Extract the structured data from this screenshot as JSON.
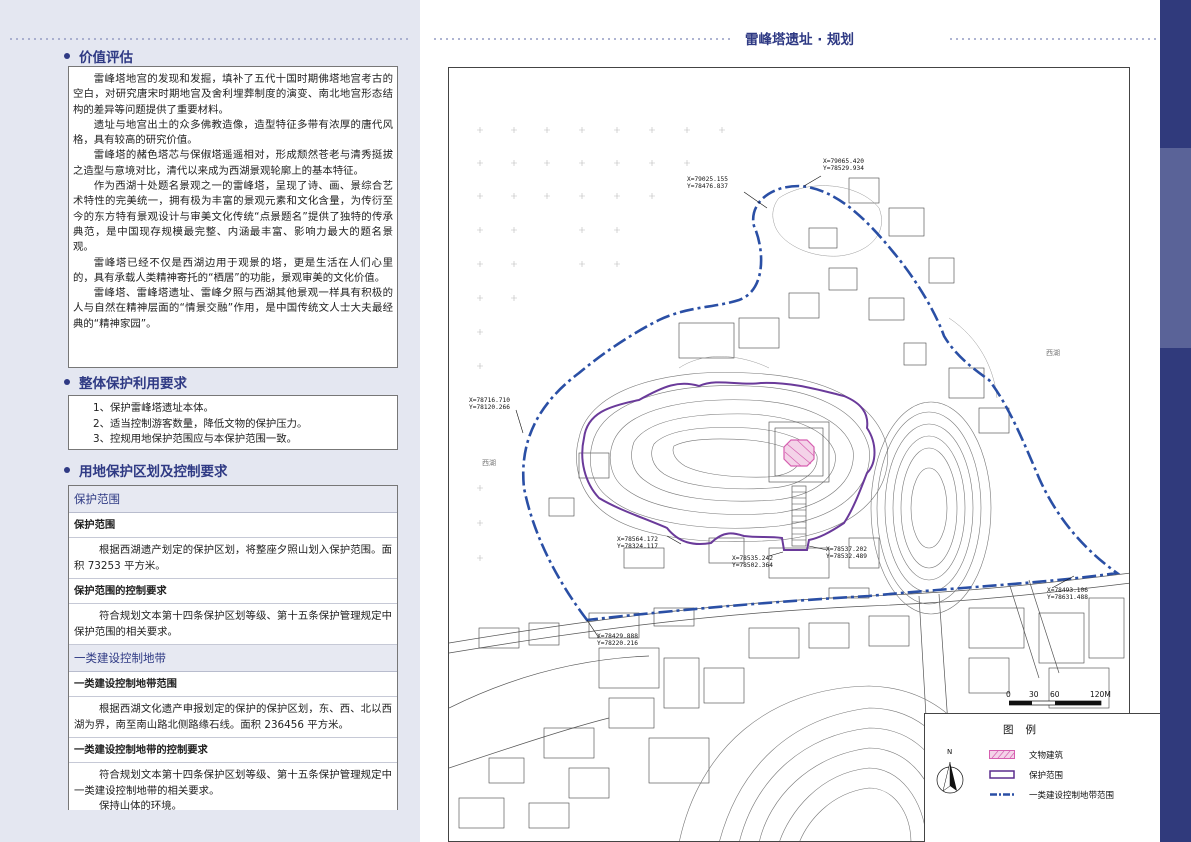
{
  "header": {
    "map_title": "雷峰塔遗址 · 规划"
  },
  "value_section": {
    "heading": "价值评估",
    "paragraphs": [
      "雷峰塔地宫的发现和发掘，填补了五代十国时期佛塔地宫考古的空白，对研究唐宋时期地宫及舍利埋葬制度的演变、南北地宫形态结构的差异等问题提供了重要材料。",
      "遗址与地宫出土的众多佛教造像，造型特征多带有浓厚的唐代风格，具有较高的研究价值。",
      "雷峰塔的赭色塔芯与保俶塔遥遥相对，形成颓然苍老与清秀挺拔之造型与意境对比，清代以来成为西湖景观轮廓上的基本特征。",
      "作为西湖十处题名景观之一的雷峰塔，呈现了诗、画、景综合艺术特性的完美统一，拥有极为丰富的景观元素和文化含量，为传衍至今的东方特有景观设计与审美文化传统“点景题名”提供了独特的传承典范，是中国现存规模最完整、内涵最丰富、影响力最大的题名景观。",
      "雷峰塔已经不仅是西湖边用于观景的塔，更是生活在人们心里的，具有承载人类精神寄托的“栖居”的功能，景观审美的文化价值。",
      "雷峰塔、雷峰塔遗址、雷峰夕照与西湖其他景观一样具有积极的人与自然在精神层面的“情景交融”作用，是中国传统文人士大夫最经典的“精神家园”。"
    ]
  },
  "requirements_section": {
    "heading": "整体保护利用要求",
    "items": [
      "1、保护雷峰塔遗址本体。",
      "2、适当控制游客数量，降低文物的保护压力。",
      "3、控规用地保护范围应与本保护范围一致。"
    ]
  },
  "zoning_section": {
    "heading": "用地保护区划及控制要求",
    "protect_title": "保护范围",
    "protect_sub1": "保护范围",
    "protect_text1": "根据西湖遗产划定的保护区划，将整座夕照山划入保护范围。面积 73253 平方米。",
    "protect_sub2": "保护范围的控制要求",
    "protect_text2": "符合规划文本第十四条保护区划等级、第十五条保护管理规定中保护范围的相关要求。",
    "zone1_title": "一类建设控制地带",
    "zone1_sub1": "一类建设控制地带范围",
    "zone1_text1": "根据西湖文化遗产申报划定的保护的保护区划，东、西、北以西湖为界，南至南山路北侧路缘石线。面积 236456 平方米。",
    "zone1_sub2": "一类建设控制地带的控制要求",
    "zone1_text2": "符合规划文本第十四条保护区划等级、第十五条保护管理规定中一类建设控制地带的相关要求。",
    "zone1_text3": "保持山体的环境。"
  },
  "map": {
    "coordinates": [
      {
        "x": "X=79065.420",
        "y": "Y=78529.934"
      },
      {
        "x": "X=79025.155",
        "y": "Y=78476.837"
      },
      {
        "x": "X=78716.710",
        "y": "Y=78120.266"
      },
      {
        "x": "X=78564.172",
        "y": "Y=78324.117"
      },
      {
        "x": "X=78535.242",
        "y": "Y=78502.364"
      },
      {
        "x": "X=78537.202",
        "y": "Y=78532.489"
      },
      {
        "x": "X=78493.106",
        "y": "Y=78631.488"
      },
      {
        "x": "X=78429.888",
        "y": "Y=78220.216"
      }
    ],
    "places": {
      "west": "西湖",
      "east": "西湖"
    },
    "scale_labels": [
      "0",
      "30",
      "60",
      "120M"
    ],
    "north_label": "N"
  },
  "legend": {
    "title": "图例",
    "items": [
      {
        "label": "文物建筑",
        "color": "#d65fb0"
      },
      {
        "label": "保护范围",
        "color": "#5b2d8e"
      },
      {
        "label": "一类建设控制地带范围",
        "color": "#2a4fa5"
      }
    ]
  },
  "colors": {
    "accent": "#2f3a84",
    "protect_line": "#6a3a9a",
    "control_line": "#2a4fa5",
    "relic": "#d65fb0"
  }
}
